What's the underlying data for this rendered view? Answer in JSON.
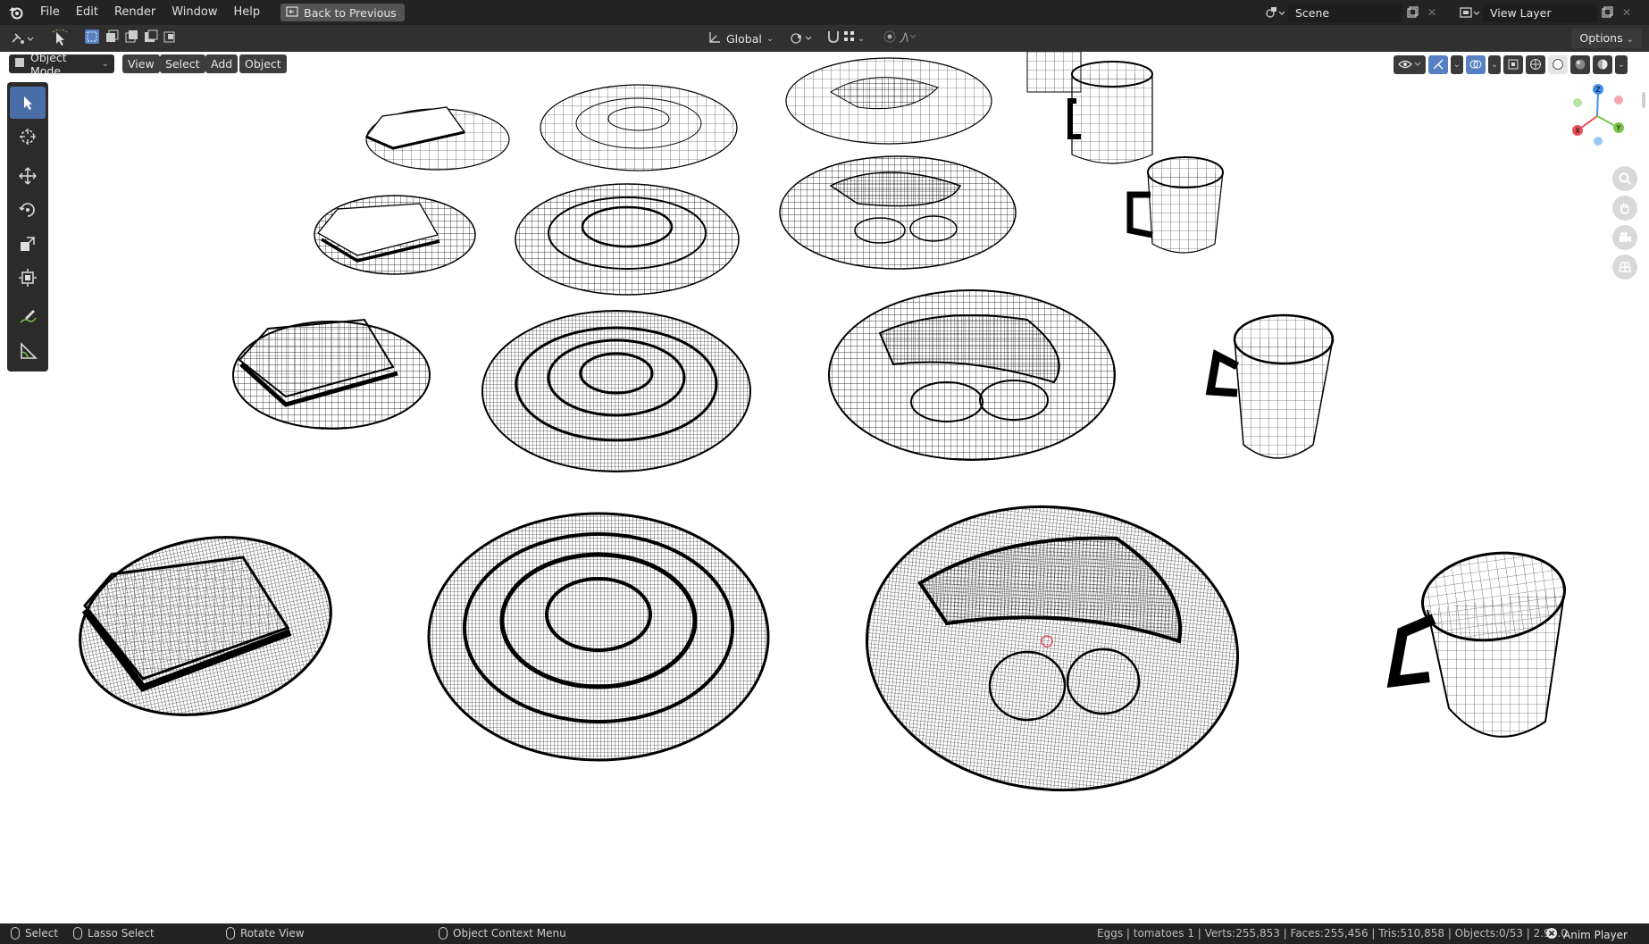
{
  "topbar": {
    "menus": [
      "File",
      "Edit",
      "Render",
      "Window",
      "Help"
    ],
    "back_button": "Back to Previous",
    "scene_label": "Scene",
    "view_layer_label": "View Layer"
  },
  "toolheader": {
    "transform_orientation": "Global",
    "options_label": "Options"
  },
  "viewport": {
    "mode": "Object Mode",
    "menus": [
      "View",
      "Select",
      "Add",
      "Object"
    ],
    "gizmo_axes": [
      "X",
      "Y",
      "Z"
    ]
  },
  "statusbar": {
    "select": "Select",
    "lasso_select": "Lasso Select",
    "rotate_view": "Rotate View",
    "context_menu": "Object Context Menu",
    "stats": "Eggs | tomatoes 1 | Verts:255,853 | Faces:255,456 | Tris:510,858 | Objects:0/53 | 2.90.0",
    "anim_player": "Anim Player"
  },
  "colors": {
    "topbar_bg": "#232323",
    "header_bg": "#303030",
    "accent": "#4a6fa8",
    "viewport_bg": "#ffffff",
    "axis_x": "#e8505b",
    "axis_y": "#7ac54a",
    "axis_z": "#3f8ff0"
  }
}
